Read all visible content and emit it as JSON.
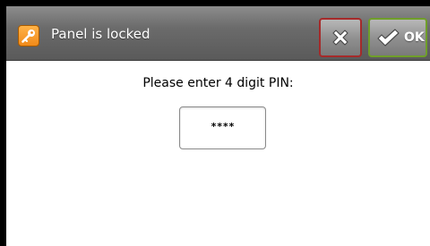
{
  "dialog": {
    "title": "Panel is locked",
    "title_icon": "key-icon",
    "cancel_icon": "close-x-icon",
    "ok_icon": "checkmark-icon",
    "ok_label": "OK",
    "prompt": "Please enter 4 digit PIN:",
    "pin_value": "****"
  },
  "colors": {
    "titlebar": "#6b6b6b",
    "cancel_border": "#a52a2a",
    "ok_border": "#6f9e2a",
    "key_icon": "#f08a1a"
  }
}
